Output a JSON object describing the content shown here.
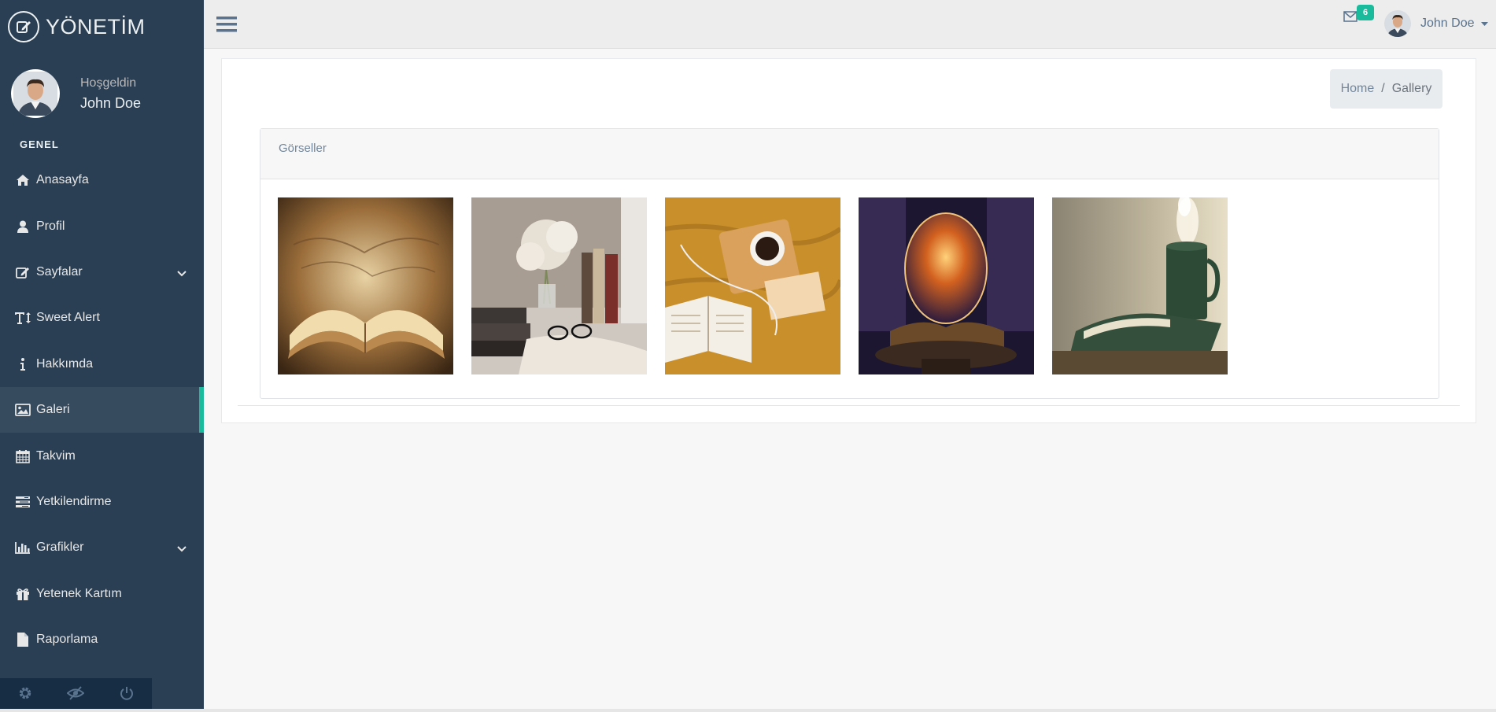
{
  "brand": {
    "title": "YÖNETİM"
  },
  "profile": {
    "welcome": "Hoşgeldin",
    "name": "John Doe"
  },
  "sidebar": {
    "section_title": "GENEL",
    "items": [
      {
        "label": "Anasayfa",
        "icon": "home-icon"
      },
      {
        "label": "Profil",
        "icon": "user-icon"
      },
      {
        "label": "Sayfalar",
        "icon": "edit-icon",
        "has_submenu": true
      },
      {
        "label": "Sweet Alert",
        "icon": "text-height-icon"
      },
      {
        "label": "Hakkımda",
        "icon": "info-icon"
      },
      {
        "label": "Galeri",
        "icon": "image-icon",
        "active": true
      },
      {
        "label": "Takvim",
        "icon": "calendar-icon"
      },
      {
        "label": "Yetkilendirme",
        "icon": "tasks-icon"
      },
      {
        "label": "Grafikler",
        "icon": "bar-chart-icon",
        "has_submenu": true
      },
      {
        "label": "Yetenek Kartım",
        "icon": "gift-icon"
      },
      {
        "label": "Raporlama",
        "icon": "file-icon"
      }
    ],
    "footer": [
      "settings-icon",
      "eye-slash-icon",
      "power-icon"
    ]
  },
  "topnav": {
    "notification_count": "6",
    "user_name": "John Doe"
  },
  "breadcrumb": {
    "home": "Home",
    "separator": "/",
    "current": "Gallery"
  },
  "gallery": {
    "title": "Görseller",
    "images": [
      "book-map-image",
      "flowers-books-image",
      "coffee-book-image",
      "magic-crystal-book-image",
      "mug-book-image"
    ]
  },
  "colors": {
    "sidebar_bg": "#2a3f54",
    "sidebar_active": "#374b5f",
    "accent": "#1abb9c",
    "topnav_bg": "#ededed",
    "page_bg": "#f7f7f7"
  }
}
